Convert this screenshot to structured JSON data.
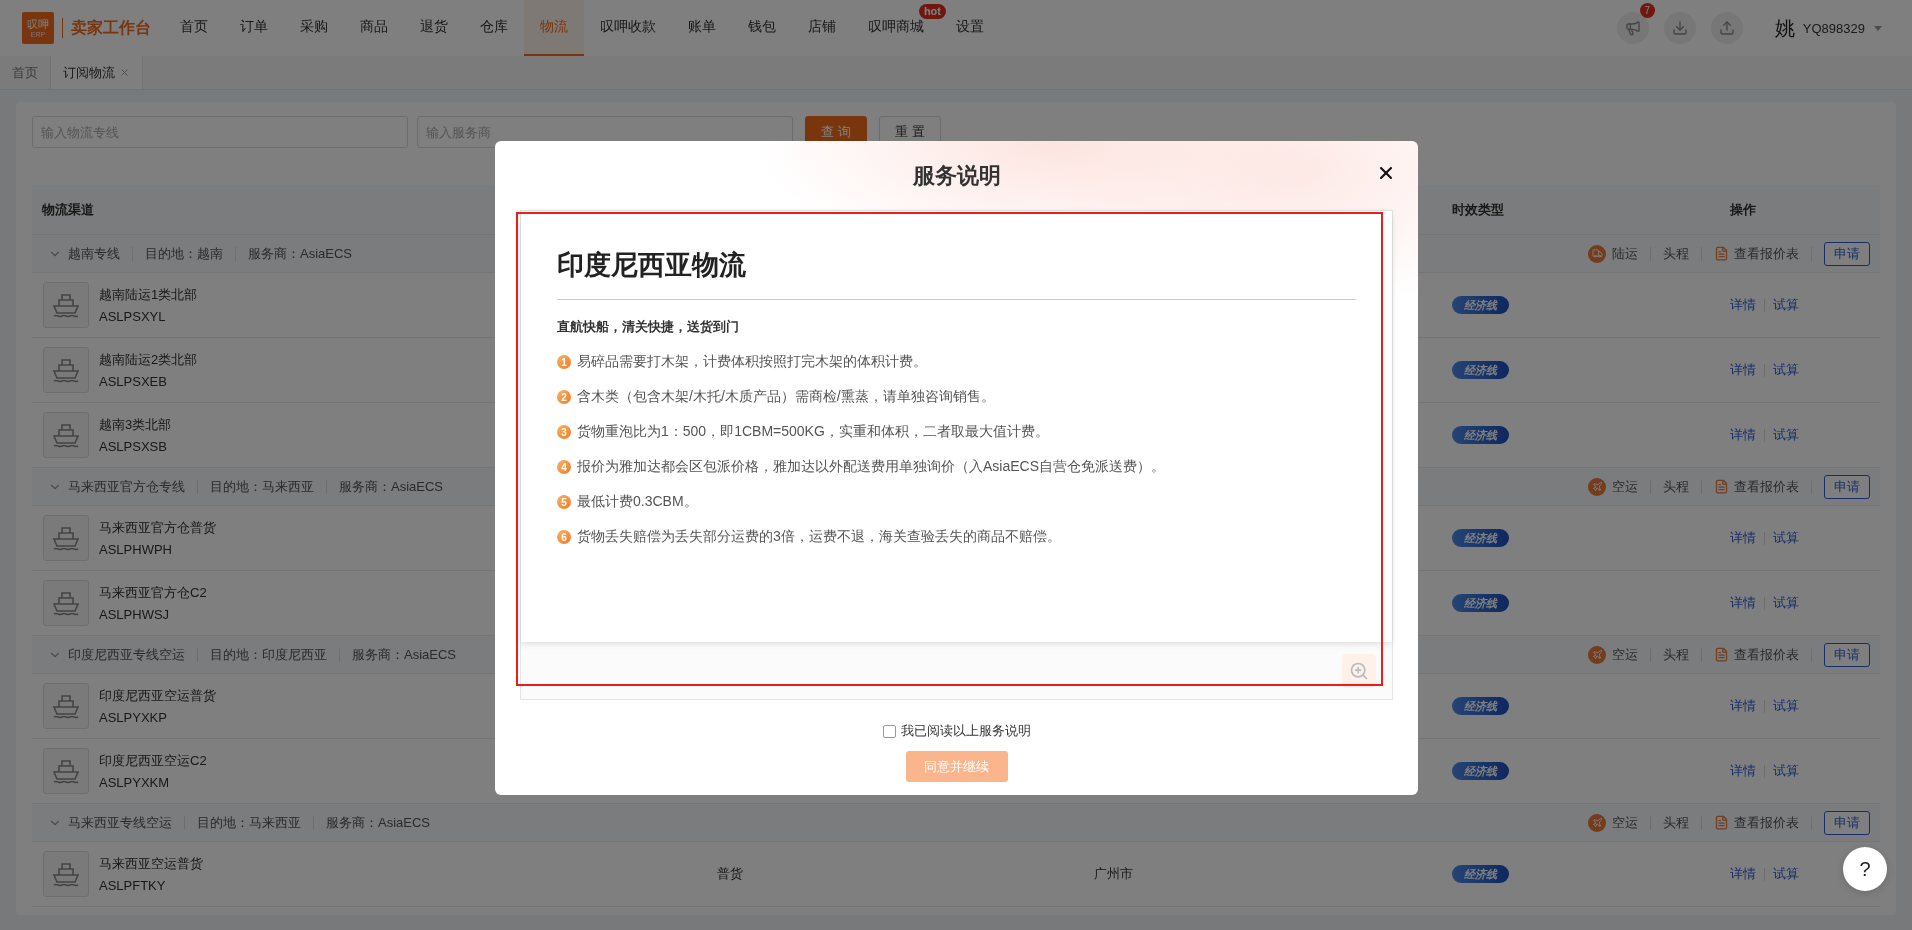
{
  "topbar": {
    "logo": {
      "mark": "叹呷",
      "sub": "ERP"
    },
    "title": "卖家工作台",
    "nav": [
      {
        "label": "首页",
        "selected": false
      },
      {
        "label": "订单",
        "selected": false
      },
      {
        "label": "采购",
        "selected": false
      },
      {
        "label": "商品",
        "selected": false
      },
      {
        "label": "退货",
        "selected": false
      },
      {
        "label": "仓库",
        "selected": false
      },
      {
        "label": "物流",
        "selected": true
      },
      {
        "label": "叹呷收款",
        "selected": false
      },
      {
        "label": "账单",
        "selected": false
      },
      {
        "label": "钱包",
        "selected": false
      },
      {
        "label": "店铺",
        "selected": false
      },
      {
        "label": "叹呷商城",
        "selected": false,
        "badge": "hot"
      },
      {
        "label": "设置",
        "selected": false
      }
    ],
    "notifications": "7",
    "avatar": "姚",
    "user": "YQ898329"
  },
  "tabs": [
    {
      "label": "首页",
      "selected": false,
      "closable": false
    },
    {
      "label": "订阅物流",
      "selected": true,
      "closable": true
    }
  ],
  "filters": {
    "route_placeholder": "输入物流专线",
    "provider_placeholder": "输入服务商",
    "buttons": [
      {
        "label": "查 询",
        "kind": "primary"
      },
      {
        "label": "重 置",
        "kind": "default"
      }
    ]
  },
  "table": {
    "columns": [
      {
        "label": "物流渠道"
      },
      {
        "label": "时效类型"
      },
      {
        "label": "操作"
      }
    ],
    "groups": [
      {
        "name": "越南专线",
        "destination": "目的地：越南",
        "provider": "服务商：AsiaECS",
        "expanded": true,
        "transport": {
          "kind": "land",
          "label": "陆运"
        },
        "stage": "头程",
        "quote": "查看报价表",
        "apply": "申请",
        "items": [
          {
            "name": "越南陆运1类北部",
            "code": "ASLPSXYL",
            "tag": "经济线",
            "actions": [
              "详情",
              "试算"
            ]
          },
          {
            "name": "越南陆运2类北部",
            "code": "ASLPSXEB",
            "tag": "经济线",
            "actions": [
              "详情",
              "试算"
            ]
          },
          {
            "name": "越南3类北部",
            "code": "ASLPSXSB",
            "tag": "经济线",
            "actions": [
              "详情",
              "试算"
            ]
          }
        ]
      },
      {
        "name": "马来西亚官方仓专线",
        "destination": "目的地：马来西亚",
        "provider": "服务商：AsiaECS",
        "expanded": true,
        "transport": {
          "kind": "air",
          "label": "空运"
        },
        "stage": "头程",
        "quote": "查看报价表",
        "apply": "申请",
        "items": [
          {
            "name": "马来西亚官方仓普货",
            "code": "ASLPHWPH",
            "tag": "经济线",
            "actions": [
              "详情",
              "试算"
            ]
          },
          {
            "name": "马来西亚官方仓C2",
            "code": "ASLPHWSJ",
            "tag": "经济线",
            "actions": [
              "详情",
              "试算"
            ]
          }
        ]
      },
      {
        "name": "印度尼西亚专线空运",
        "destination": "目的地：印度尼西亚",
        "provider": "服务商：AsiaECS",
        "expanded": true,
        "transport": {
          "kind": "air",
          "label": "空运"
        },
        "stage": "头程",
        "quote": "查看报价表",
        "apply": "申请",
        "items": [
          {
            "name": "印度尼西亚空运普货",
            "code": "ASLPYXKP",
            "tag": "经济线",
            "actions": [
              "详情",
              "试算"
            ]
          },
          {
            "name": "印度尼西亚空运C2",
            "code": "ASLPYXKM",
            "tag": "经济线",
            "actions": [
              "详情",
              "试算"
            ]
          }
        ]
      },
      {
        "name": "马来西亚专线空运",
        "destination": "目的地：马来西亚",
        "provider": "服务商：AsiaECS",
        "expanded": true,
        "transport": {
          "kind": "air",
          "label": "空运"
        },
        "stage": "头程",
        "quote": "查看报价表",
        "apply": "申请",
        "items": [
          {
            "name": "马来西亚空运普货",
            "code": "ASLPFTKY",
            "cargo": "普货",
            "city": "广州市",
            "tag": "经济线",
            "actions": [
              "详情",
              "试算"
            ]
          }
        ]
      }
    ]
  },
  "dialog": {
    "title": "服务说明",
    "highlighted": true,
    "doc": {
      "heading": "印度尼西亚物流",
      "subtitle": "直航快船，清关快捷，送货到门",
      "points": [
        {
          "number": "1",
          "text": "易碎品需要打木架，计费体积按照打完木架的体积计费。"
        },
        {
          "number": "2",
          "text": "含木类（包含木架/木托/木质产品）需商检/熏蒸，请单独咨询销售。"
        },
        {
          "number": "3",
          "text": "货物重泡比为1：500，即1CBM=500KG，实重和体积，二者取最大值计费。"
        },
        {
          "number": "4",
          "text": "报价为雅加达都会区包派价格，雅加达以外配送费用单独询价（入AsiaECS自营仓免派送费）。"
        },
        {
          "number": "5",
          "text": "最低计费0.3CBM。"
        },
        {
          "number": "6",
          "text": "货物丢失赔偿为丢失部分运费的3倍，运费不退，海关查验丢失的商品不赔偿。"
        }
      ]
    },
    "agree": {
      "label": "我已阅读以上服务说明",
      "checked": false
    },
    "confirm": {
      "label": "同意并继续",
      "disabled": true
    }
  },
  "help": "?"
}
